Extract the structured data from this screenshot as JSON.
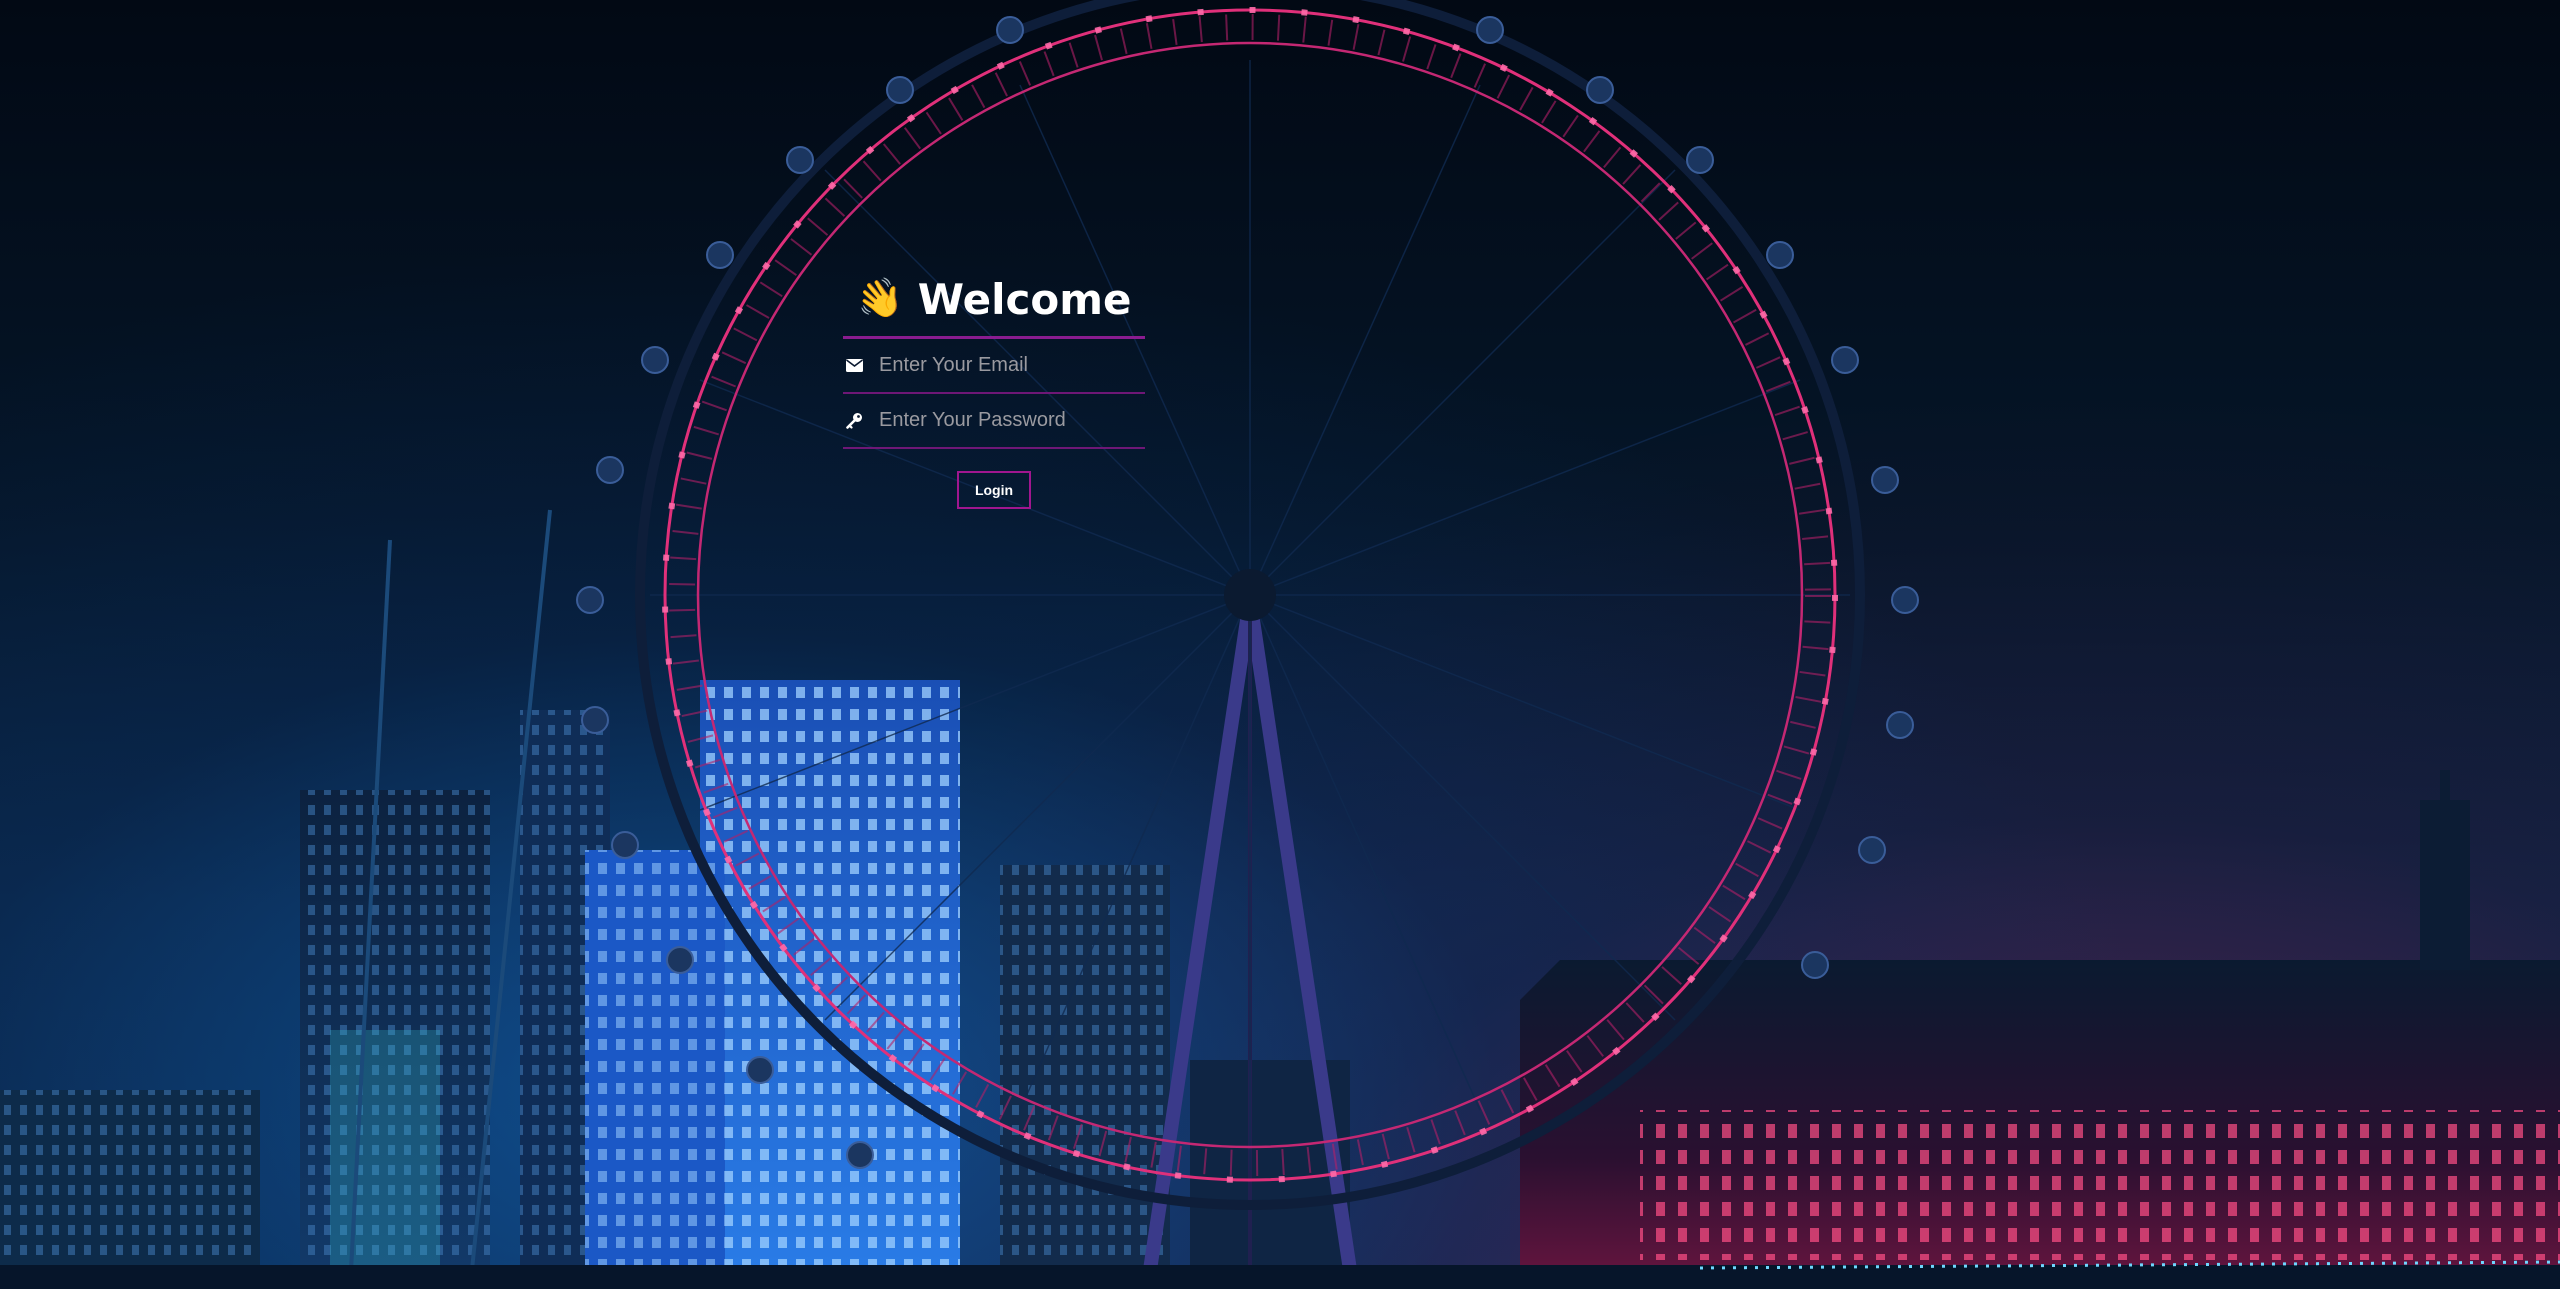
{
  "login": {
    "title": "Welcome",
    "title_icon": "waving-hand-icon",
    "email_placeholder": "Enter Your Email",
    "email_icon": "envelope-icon",
    "password_placeholder": "Enter Your Password",
    "password_icon": "key-icon",
    "button_label": "Login"
  },
  "colors": {
    "accent": "#8a1c8f",
    "button_border": "#a0168f",
    "text": "#ffffff",
    "placeholder": "#9a9aa0"
  }
}
